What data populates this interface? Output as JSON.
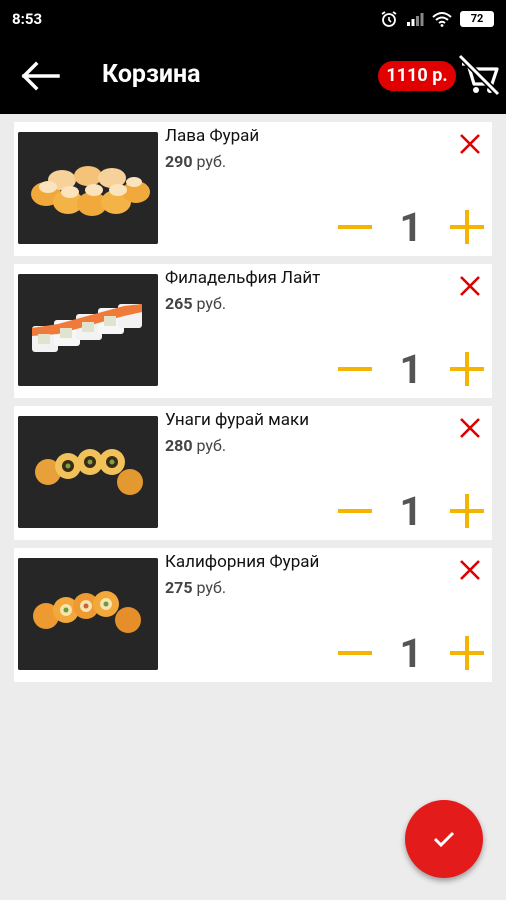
{
  "status": {
    "time": "8:53",
    "battery": "72"
  },
  "toolbar": {
    "title": "Корзина",
    "total": "1110 р."
  },
  "items": [
    {
      "name": "Лава Фурай",
      "price": "290",
      "currency": "руб.",
      "qty": "1"
    },
    {
      "name": "Филадельфия Лайт",
      "price": "265",
      "currency": "руб.",
      "qty": "1"
    },
    {
      "name": "Унаги фурай маки",
      "price": "280",
      "currency": "руб.",
      "qty": "1"
    },
    {
      "name": "Калифорния Фурай",
      "price": "275",
      "currency": "руб.",
      "qty": "1"
    }
  ],
  "colors": {
    "accent": "#f5b400",
    "remove": "#e00000",
    "badge": "#e00000",
    "fab": "#e41b1b"
  },
  "icons": {
    "back": "arrow-left-icon",
    "clear": "cart-off-icon",
    "remove": "close-icon",
    "minus": "minus-icon",
    "plus": "plus-icon",
    "confirm": "check-icon"
  }
}
